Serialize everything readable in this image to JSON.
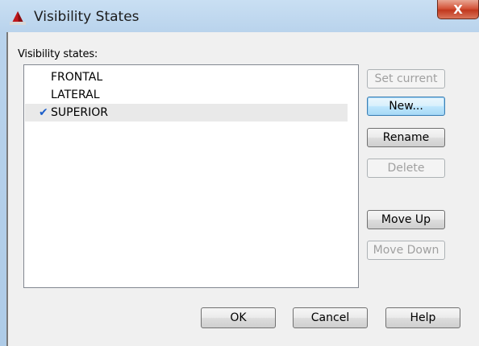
{
  "window": {
    "title": "Visibility States",
    "close_label": "X"
  },
  "group": {
    "label": "Visibility states:"
  },
  "list": {
    "items": [
      {
        "label": "FRONTAL",
        "current": false
      },
      {
        "label": "LATERAL",
        "current": false
      },
      {
        "label": "SUPERIOR",
        "current": true
      }
    ],
    "check_glyph": "✔"
  },
  "side_buttons": {
    "set_current": "Set current",
    "new": "New...",
    "rename": "Rename",
    "delete": "Delete",
    "move_up": "Move Up",
    "move_down": "Move Down"
  },
  "bottom_buttons": {
    "ok": "OK",
    "cancel": "Cancel",
    "help": "Help"
  },
  "colors": {
    "accent": "#1c5ec9",
    "close": "#c1381e"
  }
}
